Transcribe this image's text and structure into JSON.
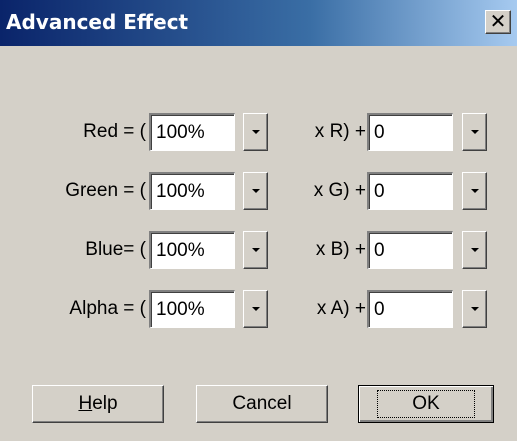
{
  "window": {
    "title": "Advanced Effect",
    "close_symbol": "✕",
    "close_icon": "close-icon"
  },
  "rows": [
    {
      "left_label": "Red = (",
      "percent": "100%",
      "mid_label": "x R) +",
      "offset": "0"
    },
    {
      "left_label": "Green = (",
      "percent": "100%",
      "mid_label": "x G) +",
      "offset": "0"
    },
    {
      "left_label": "Blue= (",
      "percent": "100%",
      "mid_label": "x B) +",
      "offset": "0"
    },
    {
      "left_label": "Alpha = (",
      "percent": "100%",
      "mid_label": "x A) +",
      "offset": "0"
    }
  ],
  "buttons": {
    "help_mnemonic": "H",
    "help_rest": "elp",
    "cancel": "Cancel",
    "ok": "OK"
  },
  "icons": {
    "dropdown": "chevron-down-icon"
  },
  "colors": {
    "dialog_bg": "#d4d0c8",
    "titlebar_start": "#0a246a",
    "titlebar_end": "#a6caf0"
  }
}
